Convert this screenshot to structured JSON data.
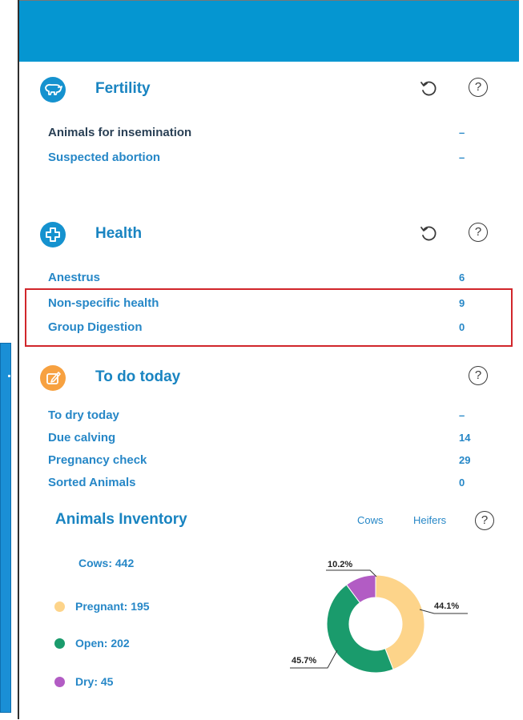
{
  "colors": {
    "accent": "#0596d1",
    "link": "#2687c7",
    "highlight_border": "#d1262b",
    "fertility_icon": "#1592cf",
    "health_icon": "#1592cf",
    "todo_icon": "#f7a140"
  },
  "fertility": {
    "title": "Fertility",
    "icon": "cow-icon",
    "rows": [
      {
        "label": "Animals for insemination",
        "value": "–"
      },
      {
        "label": "Suspected abortion",
        "value": "–"
      }
    ]
  },
  "health": {
    "title": "Health",
    "icon": "plus-cross-icon",
    "rows": [
      {
        "label": "Anestrus",
        "value": "6"
      },
      {
        "label": "Non-specific health",
        "value": "9"
      },
      {
        "label": "Group Digestion",
        "value": "0"
      }
    ]
  },
  "todo": {
    "title": "To do today",
    "icon": "pencil-note-icon",
    "rows": [
      {
        "label": "To dry today",
        "value": "–"
      },
      {
        "label": "Due calving",
        "value": "14"
      },
      {
        "label": "Pregnancy check",
        "value": "29"
      },
      {
        "label": "Sorted Animals",
        "value": "0"
      }
    ]
  },
  "inventory": {
    "title": "Animals Inventory",
    "tabs": [
      "Cows",
      "Heifers"
    ],
    "total_label": "Cows: 442",
    "legend": [
      {
        "label": "Pregnant: 195",
        "color": "#fdd48a"
      },
      {
        "label": "Open: 202",
        "color": "#1a9b6c"
      },
      {
        "label": "Dry: 45",
        "color": "#b25cc4"
      }
    ]
  },
  "chart_data": {
    "type": "pie",
    "categories": [
      "Pregnant",
      "Open",
      "Dry"
    ],
    "values": [
      195,
      202,
      45
    ],
    "percent_labels": [
      "44.1%",
      "45.7%",
      "10.2%"
    ],
    "colors": [
      "#fdd48a",
      "#1a9b6c",
      "#b25cc4"
    ],
    "donut": true
  }
}
